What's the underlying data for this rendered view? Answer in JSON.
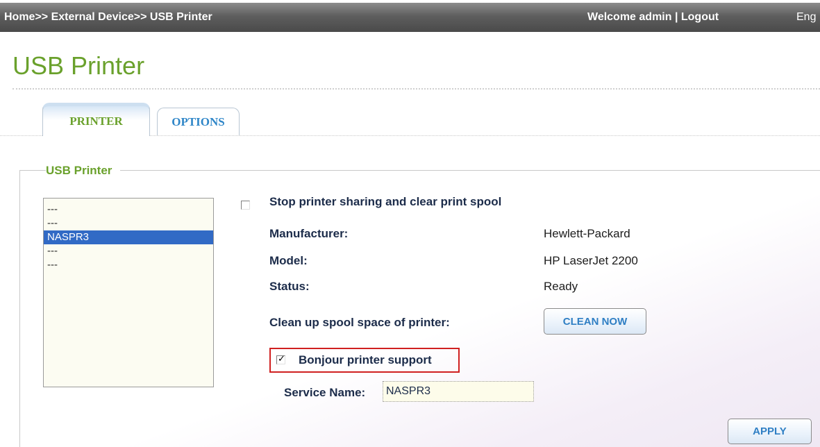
{
  "topbar": {
    "breadcrumb": "Home>> External Device>> USB Printer",
    "welcome": "Welcome admin | Logout",
    "language": "Eng"
  },
  "page": {
    "title": "USB Printer"
  },
  "tabs": [
    {
      "label": "PRINTER",
      "active": true
    },
    {
      "label": "OPTIONS",
      "active": false
    }
  ],
  "group": {
    "legend": "USB Printer"
  },
  "printer_list": {
    "items": [
      "---",
      "---",
      "NASPR3",
      "---",
      "---"
    ],
    "selected": "NASPR3"
  },
  "form": {
    "stop_sharing_label": "Stop printer sharing and clear print spool",
    "stop_sharing_checked": false,
    "manufacturer_label": "Manufacturer:",
    "manufacturer_value": "Hewlett-Packard",
    "model_label": "Model:",
    "model_value": "HP LaserJet 2200",
    "status_label": "Status:",
    "status_value": "Ready",
    "cleanup_label": "Clean up spool space of printer:",
    "clean_now_button": "CLEAN NOW",
    "bonjour_label": "Bonjour printer support",
    "bonjour_checked": true,
    "service_name_label": "Service Name:",
    "service_name_value": "NASPR3",
    "apply_button": "APPLY"
  },
  "colors": {
    "accent_green": "#6aa12c",
    "accent_blue": "#2f86c8",
    "selection_blue": "#316ac5",
    "highlight_red": "#d02020"
  }
}
